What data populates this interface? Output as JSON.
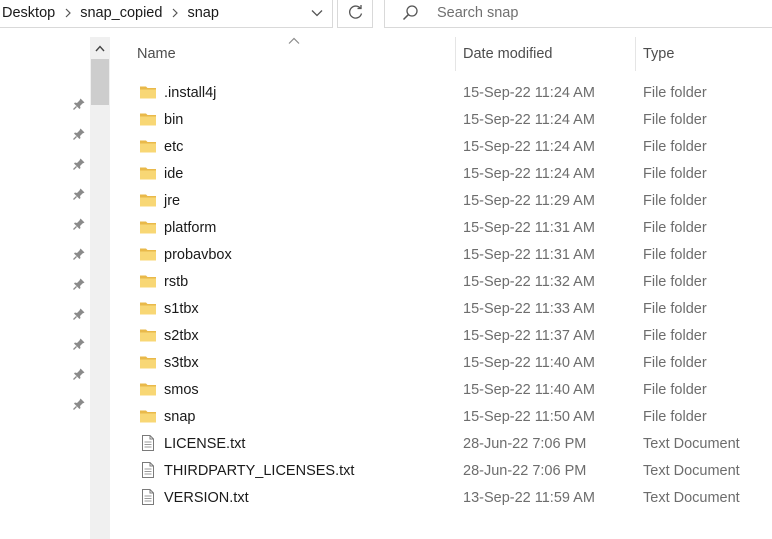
{
  "breadcrumb": [
    "Desktop",
    "snap_copied",
    "snap"
  ],
  "search": {
    "placeholder": "Search snap"
  },
  "columns": {
    "name": "Name",
    "date": "Date modified",
    "type": "Type"
  },
  "colors": {
    "folder": "#f8d775",
    "folder_dark": "#e9b94a",
    "accent": "#0078d7"
  },
  "icons": {
    "folder": "folder-icon",
    "document": "document-icon",
    "pin": "pin-icon"
  },
  "files": [
    {
      "name": ".install4j",
      "date": "15-Sep-22 11:24 AM",
      "type": "File folder",
      "kind": "folder"
    },
    {
      "name": "bin",
      "date": "15-Sep-22 11:24 AM",
      "type": "File folder",
      "kind": "folder"
    },
    {
      "name": "etc",
      "date": "15-Sep-22 11:24 AM",
      "type": "File folder",
      "kind": "folder"
    },
    {
      "name": "ide",
      "date": "15-Sep-22 11:24 AM",
      "type": "File folder",
      "kind": "folder"
    },
    {
      "name": "jre",
      "date": "15-Sep-22 11:29 AM",
      "type": "File folder",
      "kind": "folder"
    },
    {
      "name": "platform",
      "date": "15-Sep-22 11:31 AM",
      "type": "File folder",
      "kind": "folder"
    },
    {
      "name": "probavbox",
      "date": "15-Sep-22 11:31 AM",
      "type": "File folder",
      "kind": "folder"
    },
    {
      "name": "rstb",
      "date": "15-Sep-22 11:32 AM",
      "type": "File folder",
      "kind": "folder"
    },
    {
      "name": "s1tbx",
      "date": "15-Sep-22 11:33 AM",
      "type": "File folder",
      "kind": "folder"
    },
    {
      "name": "s2tbx",
      "date": "15-Sep-22 11:37 AM",
      "type": "File folder",
      "kind": "folder"
    },
    {
      "name": "s3tbx",
      "date": "15-Sep-22 11:40 AM",
      "type": "File folder",
      "kind": "folder"
    },
    {
      "name": "smos",
      "date": "15-Sep-22 11:40 AM",
      "type": "File folder",
      "kind": "folder"
    },
    {
      "name": "snap",
      "date": "15-Sep-22 11:50 AM",
      "type": "File folder",
      "kind": "folder"
    },
    {
      "name": "LICENSE.txt",
      "date": "28-Jun-22 7:06 PM",
      "type": "Text Document",
      "kind": "document"
    },
    {
      "name": "THIRDPARTY_LICENSES.txt",
      "date": "28-Jun-22 7:06 PM",
      "type": "Text Document",
      "kind": "document"
    },
    {
      "name": "VERSION.txt",
      "date": "13-Sep-22 11:59 AM",
      "type": "Text Document",
      "kind": "document"
    }
  ],
  "nav_pins": 11
}
